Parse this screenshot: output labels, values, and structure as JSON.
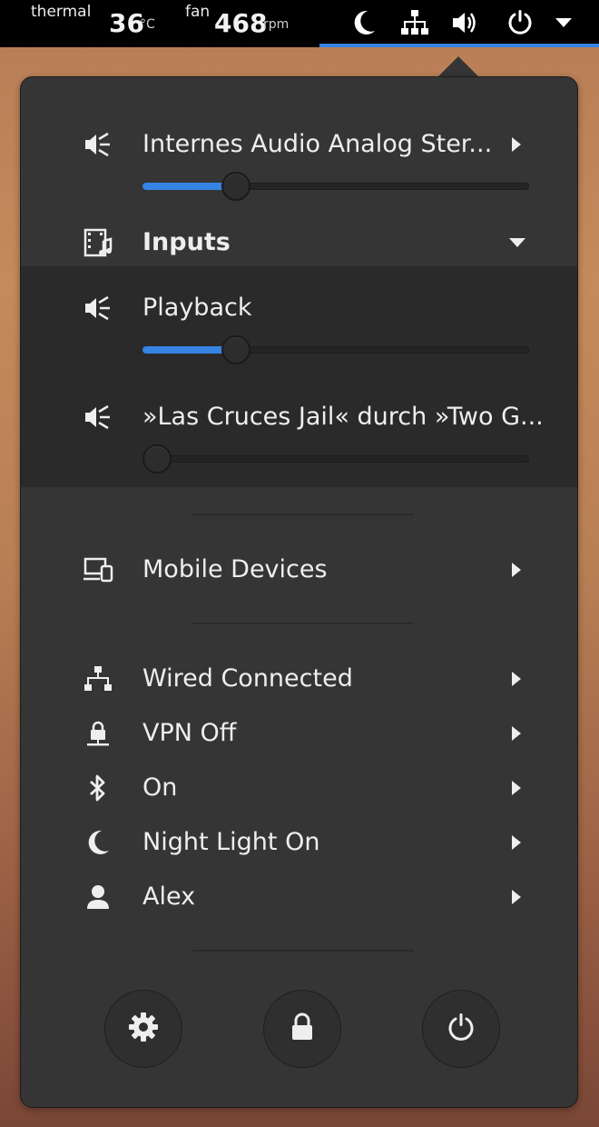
{
  "topbar": {
    "thermal_label": "thermal",
    "thermal_value": "36",
    "thermal_unit": "°C",
    "fan_label": "fan",
    "fan_value": "468",
    "fan_unit": "rpm",
    "icons": [
      "night-light-icon",
      "network-wired-icon",
      "volume-icon",
      "power-icon",
      "dropdown-arrow-icon"
    ],
    "accent": "#3584e4"
  },
  "audio": {
    "output_label": "Internes Audio Analog Ster...",
    "output_volume": 0.22,
    "inputs_label": "Inputs",
    "streams": [
      {
        "label": "Playback",
        "volume": 0.22
      },
      {
        "label": "»Las Cruces Jail« durch »Two G...",
        "volume": 0.0
      }
    ]
  },
  "mobile": {
    "label": "Mobile Devices"
  },
  "status": {
    "wired_label": "Wired Connected",
    "vpn_label": "VPN Off",
    "bluetooth_label": "On",
    "night_light_label": "Night Light On",
    "user_label": "Alex"
  },
  "actions": {
    "icons": [
      "settings-icon",
      "lock-icon",
      "power-off-icon"
    ]
  },
  "colors": {
    "panel_bg": "#353535",
    "submenu_bg": "#2a2a2a",
    "text": "#eeeeec",
    "slider_fill": "#3584e4"
  }
}
